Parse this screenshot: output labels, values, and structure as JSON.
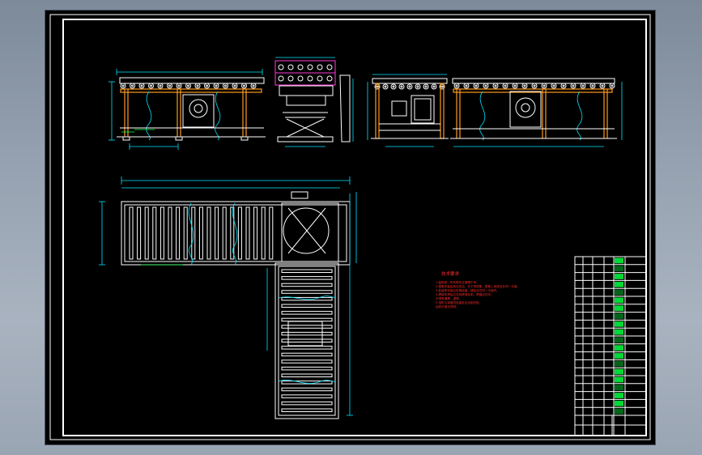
{
  "drawing": {
    "background": "#000000",
    "colors": {
      "frame": "#ffffff",
      "dimension": "#00e5ff",
      "conveyor_body": "#ff9a1f",
      "label": "#00ff40",
      "notes": "#ff2a2a",
      "lift_frame": "#ff3bd8"
    },
    "technical_requirements": {
      "title": "技术要求",
      "lines": [
        "1.装配前，所有零件应清理干净。",
        "2.辊筒安装后转动灵活，无卡滞现象，辊筒上母线应在同一平面。",
        "3.各链条安装后张紧适度，链轮应在同一平面内。",
        "4.焊接件焊后应去除焊渣毛刺，焊缝应均匀，",
        "   不得有漏焊、虚焊。",
        "5.电机与减速机连接处应涂密封胶，",
        "   运转平稳无异响。"
      ]
    },
    "parts_list": {
      "row_count": 20
    }
  }
}
